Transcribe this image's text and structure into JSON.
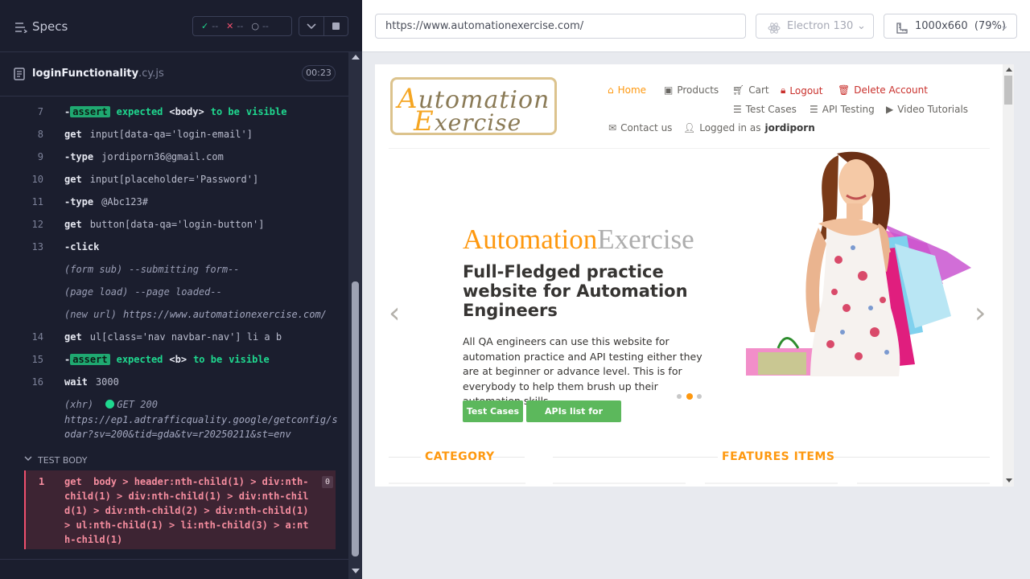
{
  "runner": {
    "specs_label": "Specs",
    "stats": {
      "passed": "--",
      "failed": "--",
      "pending": "--"
    },
    "file": {
      "name": "loginFunctionality",
      "ext": ".cy.js",
      "duration": "00:23"
    },
    "commands": [
      {
        "num": "7",
        "name": "-assert",
        "badge": true,
        "args": [
          [
            "ok",
            "expected"
          ],
          [
            "kw",
            "<body>"
          ],
          [
            "ok",
            "to be"
          ],
          [
            "ok",
            "visible"
          ]
        ]
      },
      {
        "num": "8",
        "name": "get",
        "text": "input[data-qa='login-email']"
      },
      {
        "num": "9",
        "name": "-type",
        "text": "jordiporn36@gmail.com"
      },
      {
        "num": "10",
        "name": "get",
        "text": "input[placeholder='Password']"
      },
      {
        "num": "11",
        "name": "-type",
        "text": "@Abc123#"
      },
      {
        "num": "12",
        "name": "get",
        "text": "button[data-qa='login-button']"
      },
      {
        "num": "13",
        "name": "-click",
        "text": ""
      },
      {
        "num": "",
        "name": "(form sub)",
        "event": true,
        "text": "--submitting form--"
      },
      {
        "num": "",
        "name": "(page load)",
        "event": true,
        "text": "--page loaded--"
      },
      {
        "num": "",
        "name": "(new url)",
        "event": true,
        "text": "https://www.automationexercise.com/"
      },
      {
        "num": "14",
        "name": "get",
        "text": "ul[class='nav navbar-nav'] li a b"
      },
      {
        "num": "15",
        "name": "-assert",
        "badge": true,
        "args": [
          [
            "ok",
            "expected"
          ],
          [
            "kw",
            "<b>"
          ],
          [
            "ok",
            "to be"
          ],
          [
            "ok",
            "visible"
          ]
        ]
      },
      {
        "num": "16",
        "name": "wait",
        "text": "3000"
      }
    ],
    "xhr": {
      "label": "(xhr)",
      "status": "GET 200",
      "url_line1": "https://ep1.adtrafficquality.google/getconfig/s",
      "url_line2": "odar?sv=200&tid=gda&tv=r20250211&st=env"
    },
    "test_body": {
      "header": "TEST BODY",
      "num": "1",
      "text": "get  body > header:nth-child(1) > div:nth-child(1) > div:nth-child(1) > div:nth-child(1) > div:nth-child(2) > div:nth-child(1) > ul:nth-child(1) > li:nth-child(3) > a:nth-child(1)",
      "count": "0"
    }
  },
  "browser": {
    "url": "https://www.automationexercise.com/",
    "engine": "Electron 130",
    "viewport": "1000x660",
    "zoom": "(79%)"
  },
  "site": {
    "logo": {
      "line1_big": "A",
      "line1_rest": "utomation",
      "line2_big": "E",
      "line2_rest": "xercise"
    },
    "nav": {
      "home": "Home",
      "products": "Products",
      "cart": "Cart",
      "logout": "Logout",
      "delete": "Delete Account",
      "testcases": "Test Cases",
      "api": "API Testing",
      "videos": "Video Tutorials",
      "contact": "Contact us",
      "logged_prefix": "Logged in as",
      "logged_user": "jordiporn"
    },
    "hero": {
      "title_a": "Automation",
      "title_b": "Exercise",
      "subtitle": "Full-Fledged practice website for Automation Engineers",
      "desc": "All QA engineers can use this website for automation practice and API testing either they are at beginner or advance level. This is for everybody to help them brush up their automation skills.",
      "btn_testcases": "Test Cases",
      "btn_api": "APIs list for practice"
    },
    "sections": {
      "category": "CATEGORY",
      "features": "FEATURES ITEMS"
    },
    "colors": {
      "brand": "#fe980f",
      "green": "#5cb85c",
      "danger": "#c9302c"
    }
  }
}
